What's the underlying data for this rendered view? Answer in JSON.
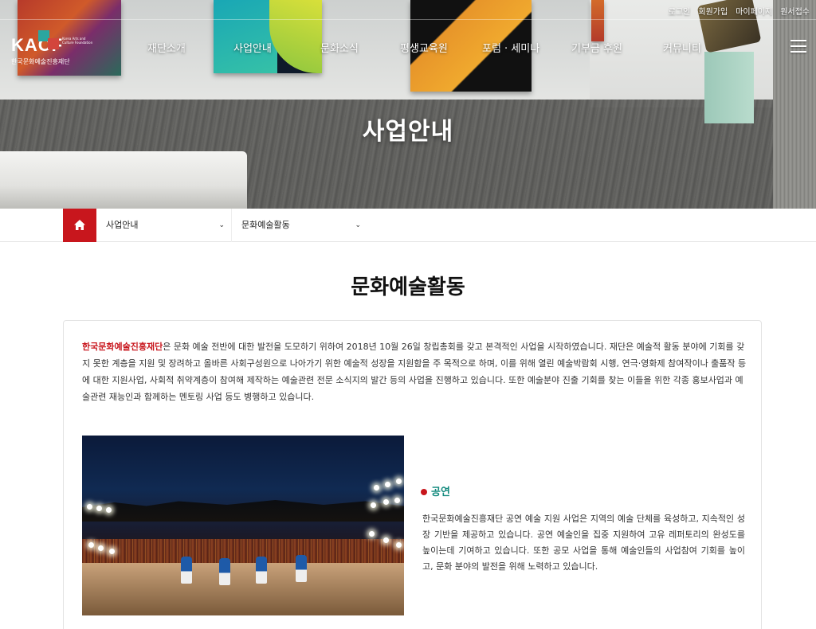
{
  "utility_links": [
    "로그인",
    "회원가입",
    "마이페이지",
    "원서접수"
  ],
  "logo": {
    "letters": "KACF",
    "subtitle": "한국문화예술진흥재단",
    "small_text": "Korea Arts and Culture Foundation"
  },
  "nav": {
    "items": [
      "재단소개",
      "사업안내",
      "문화소식",
      "평생교육원",
      "포럼 · 세미나",
      "기부금 후원",
      "커뮤니티"
    ]
  },
  "hero": {
    "title": "사업안내"
  },
  "breadcrumb": {
    "level1": "사업안내",
    "level2": "문화예술활동"
  },
  "main": {
    "title": "문화예술활동",
    "intro_highlight": "한국문화예술진흥재단",
    "intro_text": "은 문화 예술 전반에 대한 발전을 도모하기 위하여 2018년 10월 26일 창립총회를 갖고 본격적인 사업을 시작하였습니다. 재단은 예술적 활동 분야에 기회를 갖지 못한 계층을 지원 및 장려하고 올바른 사회구성원으로 나아가기 위한 예술적 성장을 지원함을 주 목적으로 하며, 이를 위해 열린 예술박람회 시행, 연극·영화제 참여작이나 출품작 등에 대한 지원사업, 사회적 취약계층이 참여해 제작하는 예술관련 전문 소식지의 발간 등의 사업을 진행하고 있습니다. 또한 예술분야 진출 기회를 찾는 이들을 위한 각종 홍보사업과 예술관련 재능인과 함께하는 멘토링 사업 등도 병행하고 있습니다.",
    "section": {
      "title": "공연",
      "body": "한국문화예술진흥재단 공연 예술 지원 사업은 지역의 예술 단체를 육성하고, 지속적인 성장 기반을 제공하고 있습니다. 공연 예술인을 집중 지원하여 고유 레퍼토리의 완성도를 높이는데 기여하고 있습니다. 또한 공모 사업을 통해 예술인들의 사업참여 기회를 높이고, 문화 분야의 발전을 위해 노력하고 있습니다."
    }
  },
  "colors": {
    "accent_red": "#c8161d",
    "section_teal": "#138a7e"
  },
  "icons": [
    "home-icon",
    "chevron-down-icon",
    "hamburger-icon"
  ]
}
